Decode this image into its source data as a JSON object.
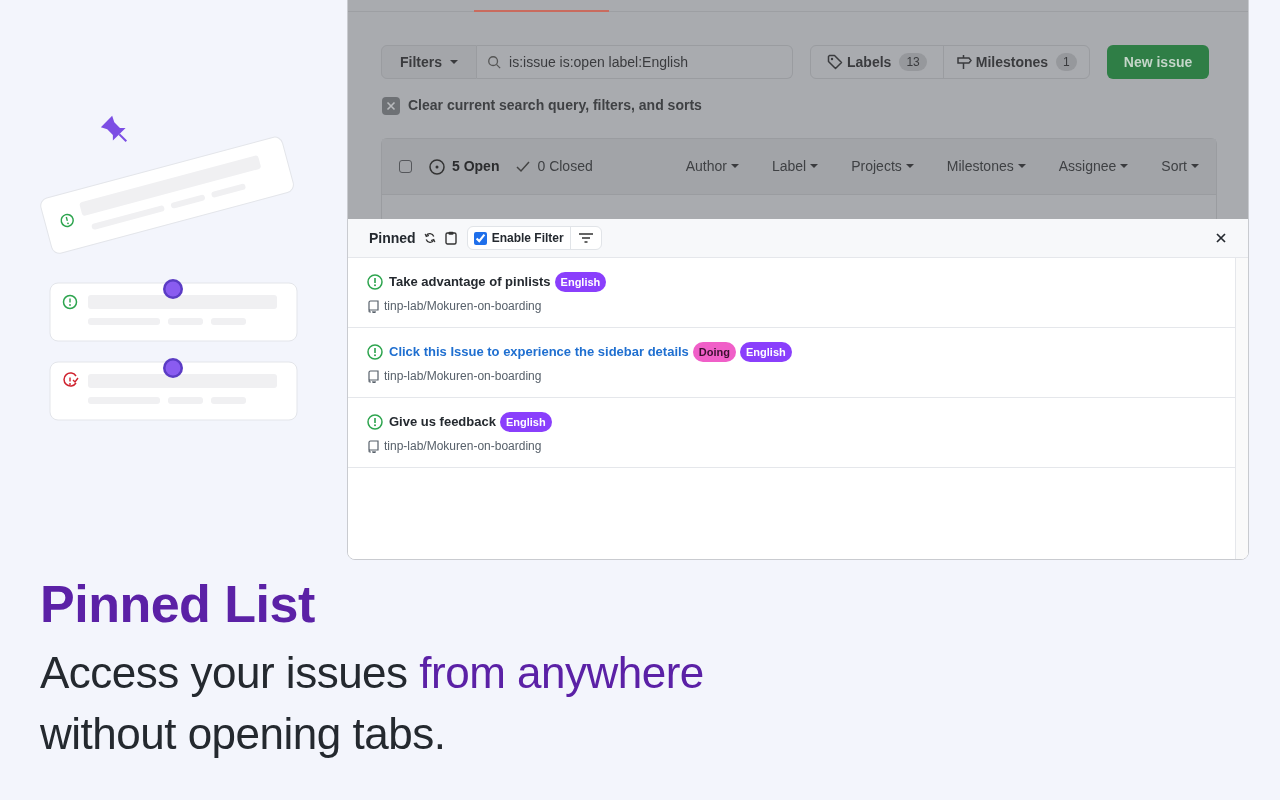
{
  "github": {
    "filters_button": "Filters",
    "search": {
      "value": "is:issue is:open label:English"
    },
    "labels_button": {
      "label": "Labels",
      "count": "13"
    },
    "milestones_button": {
      "label": "Milestones",
      "count": "1"
    },
    "new_issue_button": "New issue",
    "clear_filters": "Clear current search query, filters, and sorts",
    "select_all": {
      "checked": false
    },
    "states": [
      {
        "label": "5 Open",
        "selected": true
      },
      {
        "label": "0 Closed",
        "selected": false
      }
    ],
    "filter_menus": [
      "Author",
      "Label",
      "Projects",
      "Milestones",
      "Assignee",
      "Sort"
    ]
  },
  "pinned_panel": {
    "title": "Pinned",
    "enable_filter": {
      "label": "Enable Filter",
      "checked": true
    },
    "items": [
      {
        "title": "Take advantage of pinlists",
        "link": false,
        "labels": [
          {
            "text": "English",
            "color": "#8a3ffc"
          }
        ],
        "repo": "tinp-lab/Mokuren-on-boarding"
      },
      {
        "title": "Click this Issue to experience the sidebar details",
        "link": true,
        "labels": [
          {
            "text": "Doing",
            "color": "#f05fc8"
          },
          {
            "text": "English",
            "color": "#8a3ffc"
          }
        ],
        "repo": "tinp-lab/Mokuren-on-boarding"
      },
      {
        "title": "Give us feedback",
        "link": false,
        "labels": [
          {
            "text": "English",
            "color": "#8a3ffc"
          }
        ],
        "repo": "tinp-lab/Mokuren-on-boarding"
      }
    ]
  },
  "headline": {
    "title": "Pinned List",
    "subtitle_lines": [
      [
        {
          "text": "Access your issues ",
          "highlight": false
        },
        {
          "text": "from anywhere",
          "highlight": true
        }
      ],
      [
        {
          "text": "without opening tabs.",
          "highlight": false
        }
      ]
    ]
  }
}
